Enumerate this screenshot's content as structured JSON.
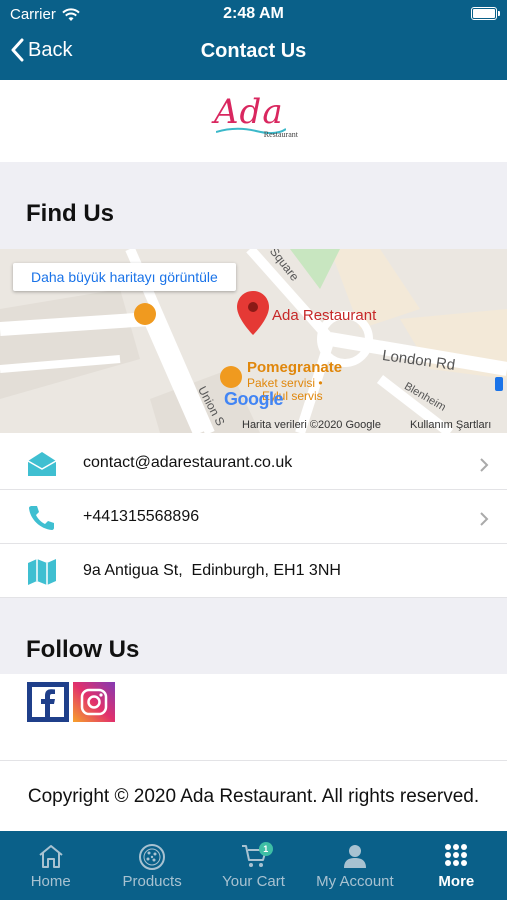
{
  "status_bar": {
    "carrier": "Carrier",
    "time": "2:48 AM"
  },
  "nav": {
    "back_label": "Back",
    "title": "Contact Us"
  },
  "logo": {
    "word": "Ada",
    "sub": "Restaurant"
  },
  "find_us": {
    "heading": "Find Us",
    "map": {
      "larger_map_link": "Daha büyük haritayı görüntüle",
      "pin_label": "Ada Restaurant",
      "poi_name": "Pomegranate",
      "poi_line1": "Paket servisi •",
      "poi_line2": "Eylul servis",
      "street1": "London Rd",
      "street2": "Union S",
      "street3": "Square",
      "street4": "Blenheim",
      "google": "Google",
      "map_data": "Harita verileri ©2020 Google",
      "terms": "Kullanım Şartları"
    }
  },
  "contacts": [
    {
      "icon": "envelope-icon",
      "text": "contact@adarestaurant.co.uk"
    },
    {
      "icon": "phone-icon",
      "text": "+441315568896"
    },
    {
      "icon": "map-icon",
      "text": "9a Antigua St,  Edinburgh, EH1 3NH"
    }
  ],
  "follow_us": {
    "heading": "Follow Us"
  },
  "footer": {
    "copyright": "Copyright © 2020 Ada Restaurant. All rights reserved."
  },
  "tabs": [
    {
      "icon": "home-icon",
      "label": "Home"
    },
    {
      "icon": "pizza-icon",
      "label": "Products"
    },
    {
      "icon": "cart-icon",
      "label": "Your Cart",
      "badge": "1"
    },
    {
      "icon": "account-icon",
      "label": "My Account"
    },
    {
      "icon": "more-grid-icon",
      "label": "More",
      "active": true
    }
  ],
  "colors": {
    "brand": "#0a6089",
    "accent": "#3fbfa5",
    "logo": "#d9275f"
  }
}
